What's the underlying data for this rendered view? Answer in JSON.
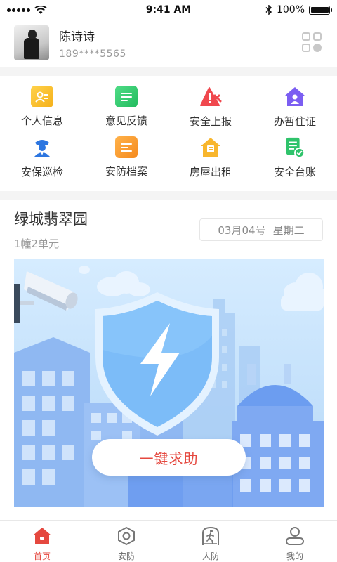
{
  "status_bar": {
    "time": "9:41 AM",
    "battery": "100%",
    "battery_level": 1.0
  },
  "profile": {
    "name": "陈诗诗",
    "phone": "189****5565"
  },
  "menu": [
    {
      "label": "个人信息",
      "icon": "id-card-icon"
    },
    {
      "label": "意见反馈",
      "icon": "feedback-icon"
    },
    {
      "label": "安全上报",
      "icon": "warning-report-icon"
    },
    {
      "label": "办暂住证",
      "icon": "residence-permit-icon"
    },
    {
      "label": "安保巡检",
      "icon": "guard-patrol-icon"
    },
    {
      "label": "安防档案",
      "icon": "security-file-icon"
    },
    {
      "label": "房屋出租",
      "icon": "house-rental-icon"
    },
    {
      "label": "安全台账",
      "icon": "security-ledger-icon"
    }
  ],
  "location": {
    "estate": "绿城翡翠园",
    "unit": "1幢2单元",
    "date": "03月04号",
    "weekday": "星期二"
  },
  "banner": {
    "sos_label": "一键求助"
  },
  "tabs": [
    {
      "label": "首页",
      "icon": "home-icon",
      "active": true
    },
    {
      "label": "安防",
      "icon": "hexagon-icon",
      "active": false
    },
    {
      "label": "人防",
      "icon": "person-run-icon",
      "active": false
    },
    {
      "label": "我的",
      "icon": "user-icon",
      "active": false
    }
  ],
  "colors": {
    "accent": "#e5483f",
    "banner_sky": "#c4e1fb",
    "shield": "#7cbcf8"
  }
}
